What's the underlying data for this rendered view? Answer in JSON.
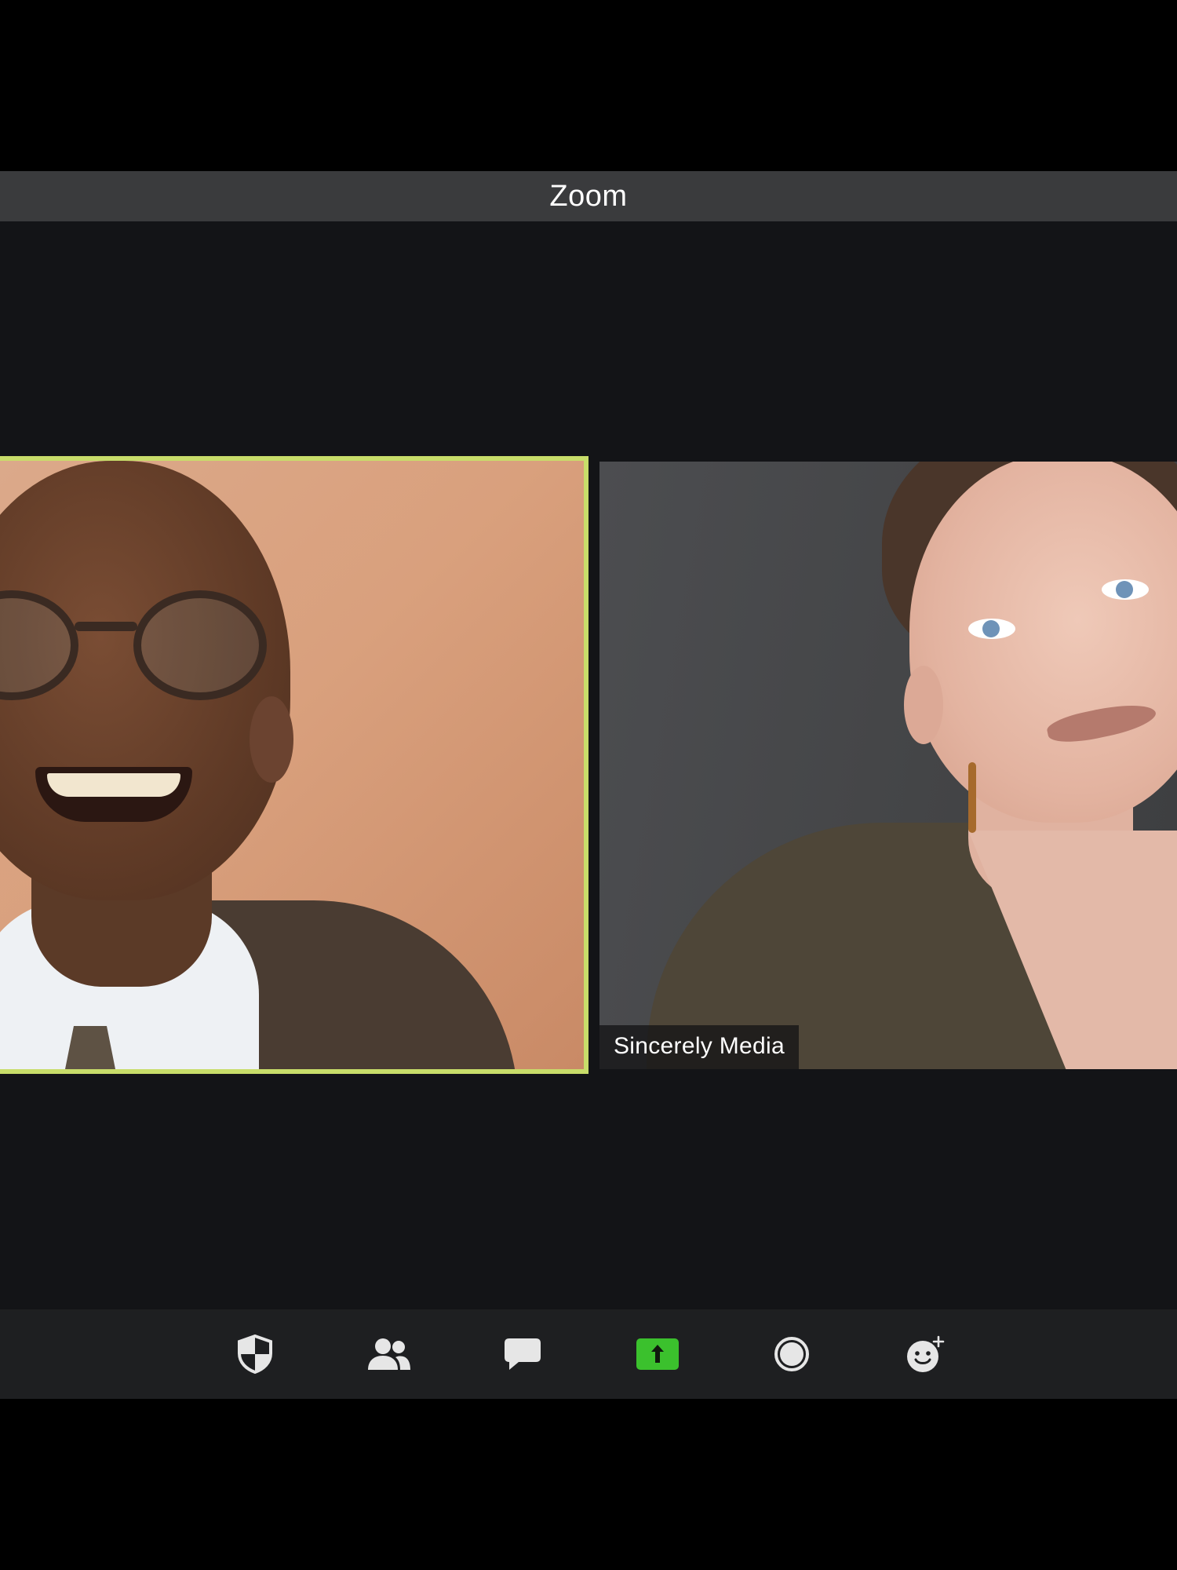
{
  "window": {
    "title": "Zoom"
  },
  "participants": [
    {
      "name": "",
      "active_speaker": true
    },
    {
      "name": "Sincerely Media",
      "active_speaker": false
    }
  ],
  "toolbar": {
    "items": [
      {
        "icon": "security-shield-icon"
      },
      {
        "icon": "participants-icon"
      },
      {
        "icon": "chat-icon"
      },
      {
        "icon": "share-screen-icon",
        "accent": "#3bc12d"
      },
      {
        "icon": "record-icon"
      },
      {
        "icon": "reactions-icon"
      }
    ]
  },
  "colors": {
    "active_speaker_border": "#c8dd6a",
    "share_screen_green": "#3bc12d",
    "titlebar": "#3a3b3d",
    "stage": "#131417",
    "toolbar": "#1e1f21"
  }
}
